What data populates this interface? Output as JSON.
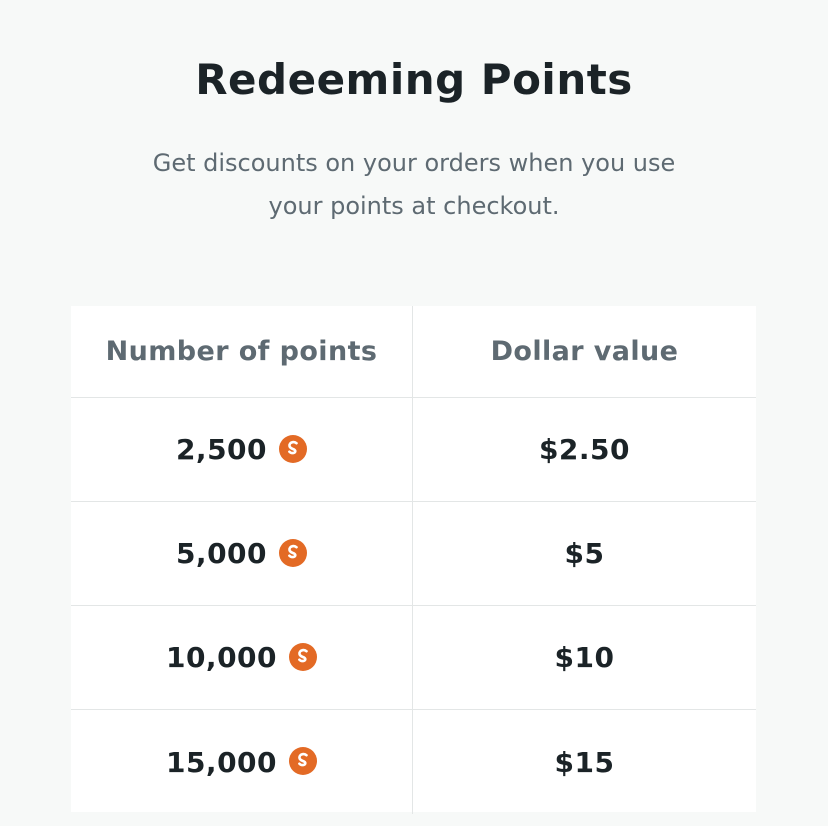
{
  "header": {
    "title": "Redeeming Points",
    "subtitle": "Get discounts on your orders when you use your points at checkout."
  },
  "table": {
    "columns": [
      "Number of points",
      "Dollar value"
    ],
    "rows": [
      {
        "points": "2,500",
        "value": "$2.50"
      },
      {
        "points": "5,000",
        "value": "$5"
      },
      {
        "points": "10,000",
        "value": "$10"
      },
      {
        "points": "15,000",
        "value": "$15"
      }
    ],
    "points_icon": "points-coin-icon",
    "points_icon_color": "#e36a25"
  }
}
